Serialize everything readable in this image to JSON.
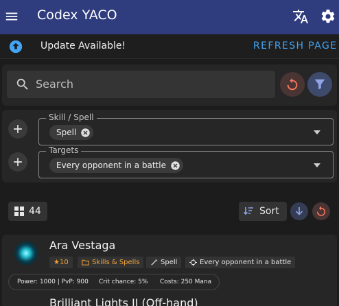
{
  "appbar": {
    "title": "Codex YACO",
    "menu_icon": "menu-icon",
    "language_icon": "translate-icon",
    "settings_icon": "gear-icon",
    "color": "#2f3c7e"
  },
  "update_banner": {
    "message": "Update Available!",
    "action": "REFRESH PAGE",
    "icon": "arrow-up-circle-icon",
    "action_color": "#42a5f5"
  },
  "search": {
    "placeholder": "Search"
  },
  "filters": [
    {
      "label": "Skill / Spell",
      "chips": [
        "Spell"
      ]
    },
    {
      "label": "Targets",
      "chips": [
        "Every opponent in a battle"
      ]
    }
  ],
  "results": {
    "count": "44",
    "sort_label": "Sort"
  },
  "cards": [
    {
      "name": "Ara Vestaga",
      "level": "★10",
      "category": "Skills & Spells",
      "type": "Spell",
      "target": "Every opponent in a battle",
      "power": "Power: 1000 | PvP: 900",
      "crit": "Crit chance: 5%",
      "cost": "Costs: 250 Mana"
    },
    {
      "name": "Brilliant Lights II (Off-hand)"
    }
  ]
}
